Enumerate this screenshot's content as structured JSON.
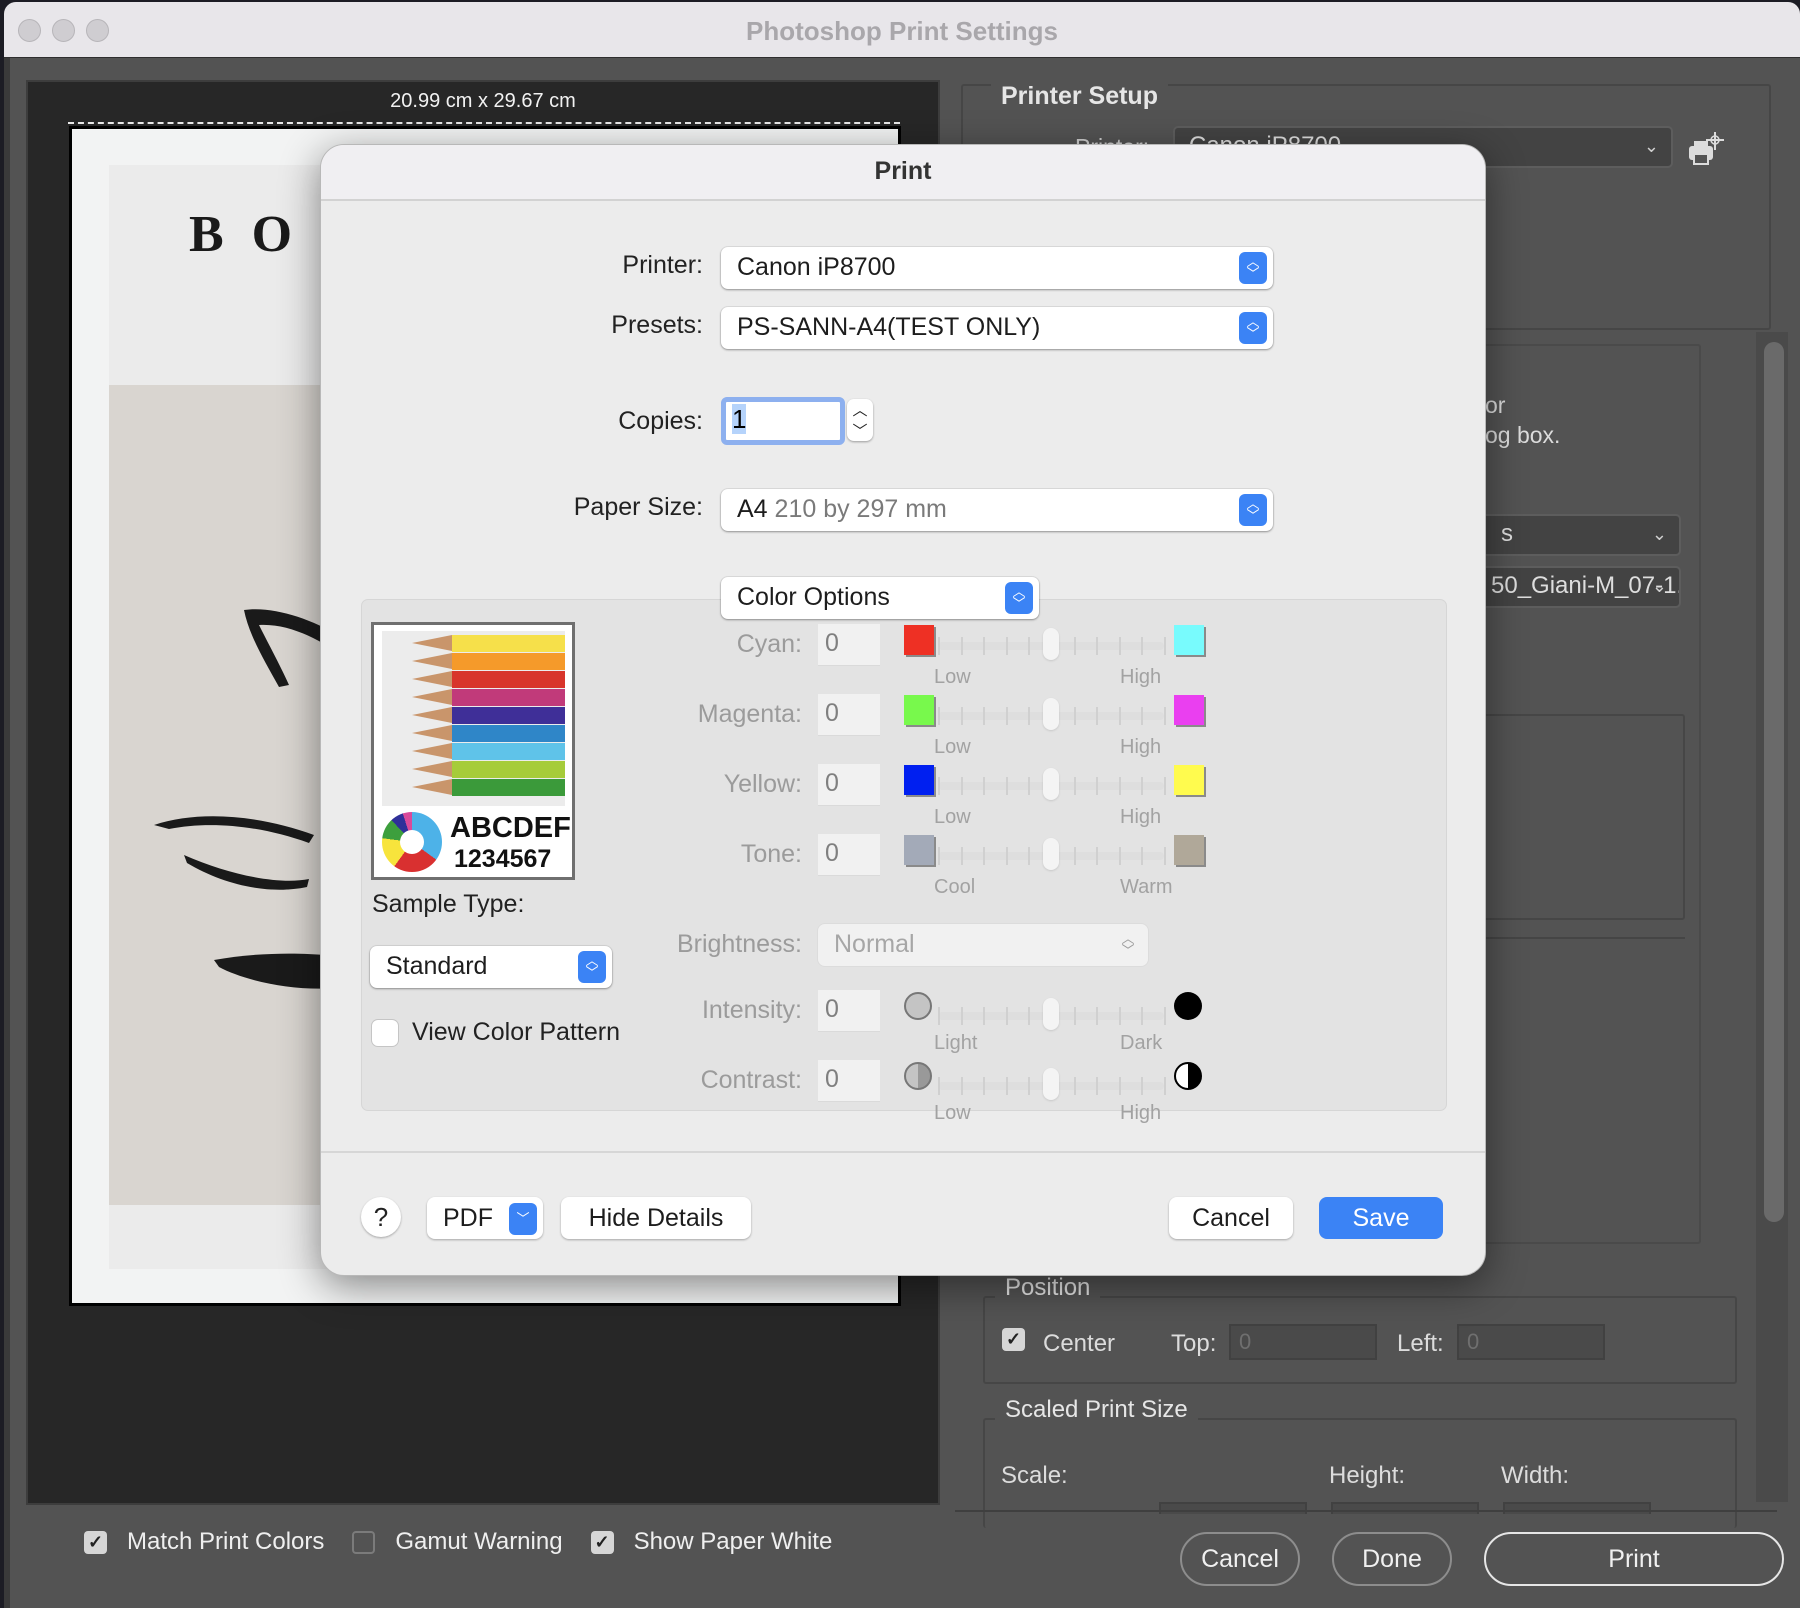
{
  "window": {
    "title": "Photoshop Print Settings"
  },
  "preview": {
    "document_size": "20.99 cm x 29.67 cm",
    "artwork_letters": "BO"
  },
  "preview_options": [
    {
      "label": "Match Print Colors",
      "checked": true
    },
    {
      "label": "Gamut Warning",
      "checked": false
    },
    {
      "label": "Show Paper White",
      "checked": true
    }
  ],
  "right_panel": {
    "printer_setup_title": "Printer Setup",
    "printer_label_partial": "Printer:",
    "printer_value_partial": "Canon iP8700",
    "note_fragment_1": "or",
    "note_fragment_2": "og box.",
    "color_handling_partial": "s",
    "profile_partial": "50_Giani-M_07-1...",
    "position": {
      "title": "Position",
      "center_label": "Center",
      "center_checked": true,
      "top_label": "Top:",
      "top_value": "0",
      "left_label": "Left:",
      "left_value": "0"
    },
    "scaled_print_size": {
      "title": "Scaled Print Size",
      "scale_label": "Scale:",
      "height_label": "Height:",
      "width_label": "Width:"
    },
    "buttons": {
      "cancel": "Cancel",
      "done": "Done",
      "print": "Print"
    }
  },
  "print_dialog": {
    "title": "Print",
    "printer_label": "Printer:",
    "printer_value": "Canon iP8700",
    "presets_label": "Presets:",
    "presets_value": "PS-SANN-A4(TEST ONLY)",
    "copies_label": "Copies:",
    "copies_value": "1",
    "paper_size_label": "Paper Size:",
    "paper_size_name": "A4",
    "paper_size_dims": "210 by 297 mm",
    "panel_menu_value": "Color Options",
    "sample": {
      "letters": "ABCDEF",
      "numbers": "1234567",
      "sample_type_label": "Sample Type:",
      "sample_type_value": "Standard",
      "view_color_pattern_label": "View Color Pattern",
      "view_color_pattern_checked": false
    },
    "adjustments": [
      {
        "label": "Cyan:",
        "value": "0",
        "low": "Low",
        "high": "High",
        "low_color": "#ee3024",
        "high_color": "#78fbfd",
        "slider_position": 0.5
      },
      {
        "label": "Magenta:",
        "value": "0",
        "low": "Low",
        "high": "High",
        "low_color": "#78f94c",
        "high_color": "#ea3ff0",
        "slider_position": 0.5
      },
      {
        "label": "Yellow:",
        "value": "0",
        "low": "Low",
        "high": "High",
        "low_color": "#001ff0",
        "high_color": "#fffb4e",
        "slider_position": 0.5
      },
      {
        "label": "Tone:",
        "value": "0",
        "low": "Cool",
        "high": "Warm",
        "low_color": "#a3aab8",
        "high_color": "#b0a899",
        "slider_position": 0.5
      }
    ],
    "brightness_label": "Brightness:",
    "brightness_value": "Normal",
    "intensity": {
      "label": "Intensity:",
      "value": "0",
      "low": "Light",
      "high": "Dark",
      "slider_position": 0.5
    },
    "contrast": {
      "label": "Contrast:",
      "value": "0",
      "low": "Low",
      "high": "High",
      "slider_position": 0.5
    },
    "footer": {
      "help": "?",
      "pdf": "PDF",
      "hide_details": "Hide Details",
      "cancel": "Cancel",
      "save": "Save"
    }
  }
}
